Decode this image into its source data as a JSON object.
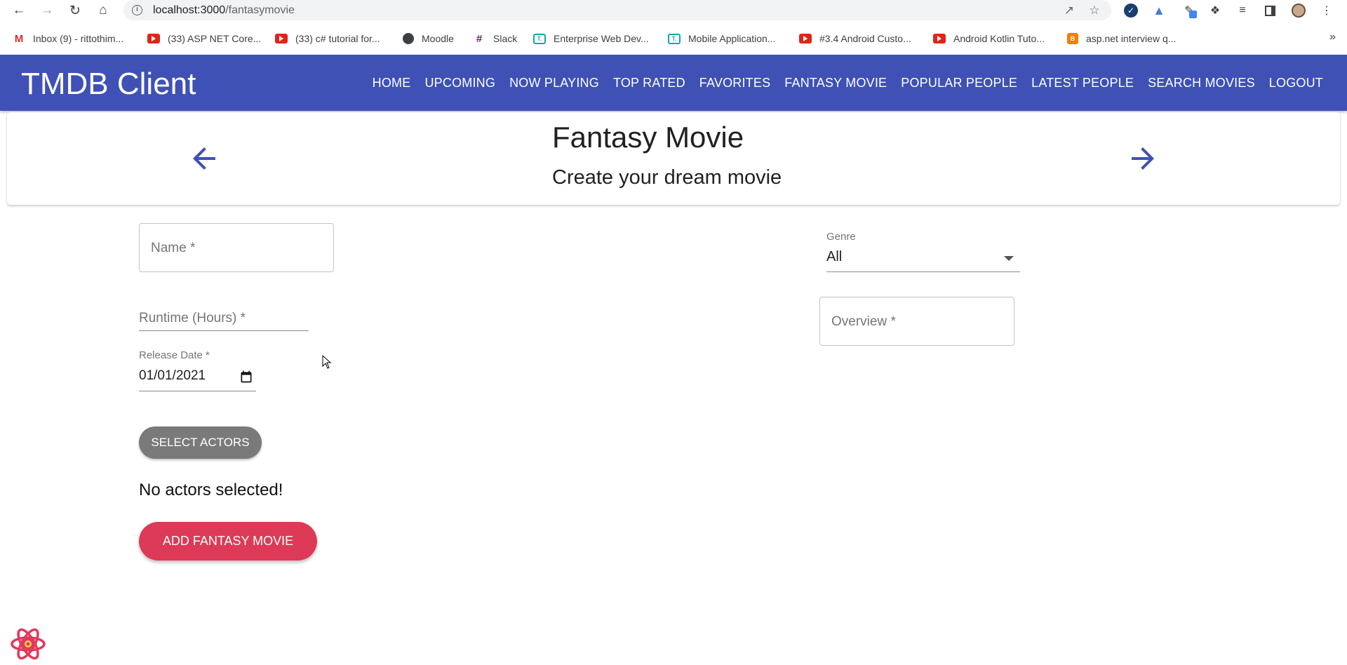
{
  "browser": {
    "url_host": "localhost:3000",
    "url_path": "/fantasymovie",
    "bookmarks": [
      {
        "label": "Inbox (9) - rittothim...",
        "icon": "gmail-icon"
      },
      {
        "label": "(33) ASP NET Core...",
        "icon": "youtube-icon"
      },
      {
        "label": "(33) c# tutorial for...",
        "icon": "youtube-icon"
      },
      {
        "label": "Moodle",
        "icon": "globe-icon"
      },
      {
        "label": "Slack",
        "icon": "slack-icon"
      },
      {
        "label": "Enterprise Web Dev...",
        "icon": "teachable-icon"
      },
      {
        "label": "Mobile Application...",
        "icon": "teachable-icon"
      },
      {
        "label": "#3.4 Android Custo...",
        "icon": "youtube-icon"
      },
      {
        "label": "Android Kotlin Tuto...",
        "icon": "youtube-icon"
      },
      {
        "label": "asp.net interview q...",
        "icon": "blogger-icon"
      }
    ],
    "more_bookmarks": "»"
  },
  "appbar": {
    "brand": "TMDB Client",
    "nav": [
      "HOME",
      "UPCOMING",
      "NOW PLAYING",
      "TOP RATED",
      "FAVORITES",
      "FANTASY MOVIE",
      "POPULAR PEOPLE",
      "LATEST PEOPLE",
      "SEARCH MOVIES",
      "LOGOUT"
    ],
    "color": "#3f51b5"
  },
  "header": {
    "title": "Fantasy Movie",
    "subtitle": "Create your dream movie"
  },
  "form": {
    "name_placeholder": "Name *",
    "runtime_placeholder": "Runtime (Hours) *",
    "release_label": "Release Date *",
    "release_value": "01/01/2021",
    "genre_label": "Genre",
    "genre_value": "All",
    "overview_placeholder": "Overview *",
    "select_actors": "SELECT ACTORS",
    "no_actors": "No actors selected!",
    "add_button": "ADD FANTASY MOVIE"
  },
  "colors": {
    "primary": "#3f51b5",
    "add_button": "#dc3a56",
    "select_button": "#7a7a7a"
  }
}
